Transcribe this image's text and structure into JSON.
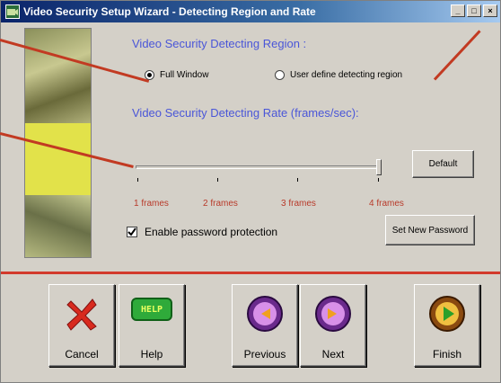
{
  "window": {
    "title": "Video Security Setup Wizard - Detecting Region and Rate",
    "title_buttons": [
      "_",
      "□",
      "×"
    ]
  },
  "region": {
    "heading": "Video Security Detecting Region :",
    "options": [
      {
        "label": "Full Window",
        "selected": true
      },
      {
        "label": "User define detecting region",
        "selected": false
      }
    ]
  },
  "rate": {
    "heading": "Video Security Detecting Rate (frames/sec):",
    "ticks": [
      "1 frames",
      "2 frames",
      "3 frames",
      "4 frames"
    ],
    "selected_index": 3,
    "default_label": "Default"
  },
  "password": {
    "checkbox_label": "Enable password protection",
    "checked": true,
    "set_button_label": "Set New Password"
  },
  "buttons": {
    "cancel": "Cancel",
    "help": "Help",
    "help_icon_text": "HELP",
    "previous": "Previous",
    "next": "Next",
    "finish": "Finish"
  },
  "colors": {
    "accent_heading": "#4a56d8",
    "tick_label": "#b83a2a",
    "divider": "#d23a2c",
    "pointer": "#c23a22"
  }
}
